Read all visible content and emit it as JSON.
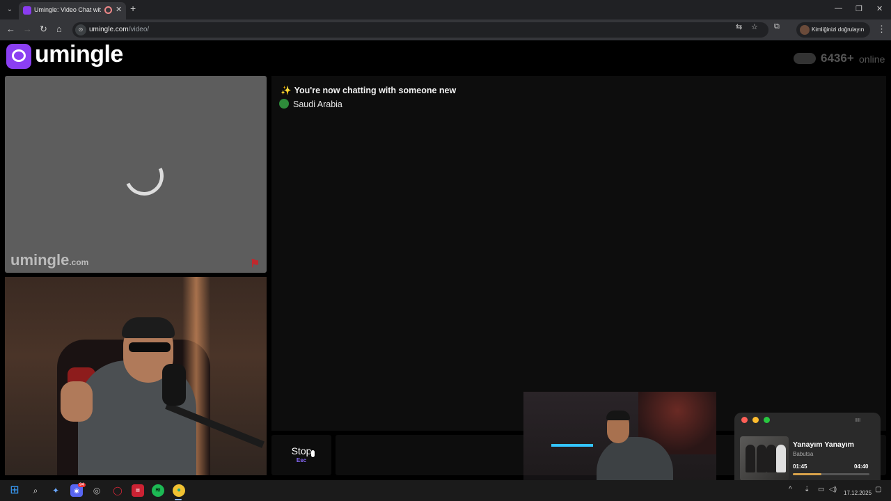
{
  "browser": {
    "tab_title": "Umingle: Video Chat with S",
    "url_host": "umingle.com",
    "url_path": "/video/",
    "profile_label": "Kimliğinizi doğrulayın",
    "controls": {
      "back": "←",
      "forward": "→",
      "reload": "↻",
      "home": "⌂",
      "new_tab": "+",
      "tab_close": "✕",
      "tab_menu": "⌄",
      "minimize": "—",
      "restore": "❐",
      "close": "✕",
      "translate": "⇆",
      "bookmark": "☆",
      "extensions": "⧉",
      "menu": "⋮"
    }
  },
  "site": {
    "logo_text": "umingle",
    "online_count": "6436+",
    "online_label": "online",
    "watermark_main": "umingle",
    "watermark_tld": ".com"
  },
  "chat": {
    "sparkle": "✨",
    "status_message": "You're now chatting with someone new",
    "country": "Saudi Arabia"
  },
  "controls": {
    "stop_label": "Stop",
    "stop_shortcut": "Esc"
  },
  "music_player": {
    "song_title": "Yanayım Yanayım",
    "artist": "Babutsa",
    "current_time": "01:45",
    "total_time": "04:40",
    "progress": 0.375,
    "colors": {
      "close": "#ff5f57",
      "minimize": "#febc2e",
      "maximize": "#28c840",
      "progress": "#d8a24a"
    }
  },
  "taskbar": {
    "discord_badge": "94",
    "date": "17.12.2025",
    "tray_chevron": "^"
  },
  "colors": {
    "brand_purple": "#8b3ff2",
    "shortcut_purple": "#8b6cff",
    "report_red": "#c0282d"
  }
}
